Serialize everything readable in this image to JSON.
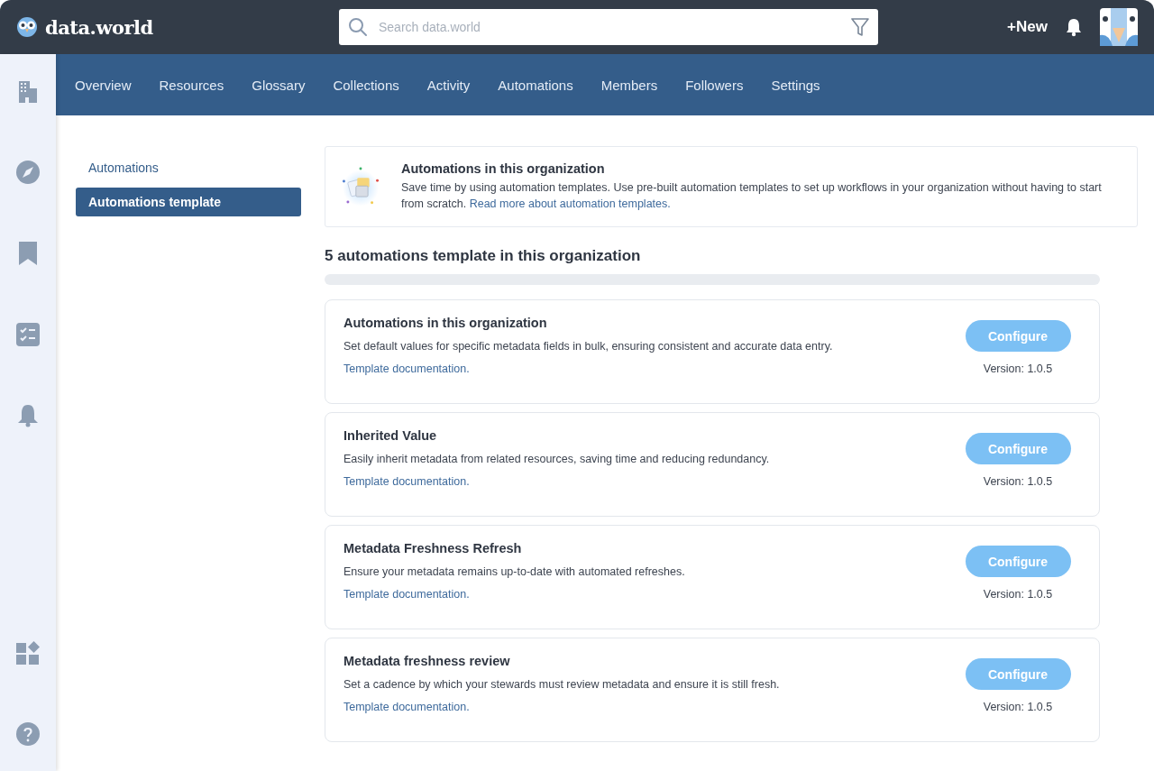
{
  "header": {
    "logo": "data.world",
    "search": {
      "placeholder": "Search data.world"
    },
    "new_button": "+New"
  },
  "nav": {
    "tabs": [
      {
        "label": "Overview",
        "selected": false
      },
      {
        "label": "Resources",
        "selected": false
      },
      {
        "label": "Glossary",
        "selected": false
      },
      {
        "label": "Collections",
        "selected": false
      },
      {
        "label": "Activity",
        "selected": false
      },
      {
        "label": "Automations",
        "selected": false
      },
      {
        "label": "Members",
        "selected": false
      },
      {
        "label": "Followers",
        "selected": false
      },
      {
        "label": "Settings",
        "selected": false
      }
    ]
  },
  "side_menu": [
    {
      "label": "Automations",
      "selected": false
    },
    {
      "label": "Automations template",
      "selected": true
    }
  ],
  "banner": {
    "title": "Automations in this organization",
    "text": "Save time by using automation templates. Use pre-built automation templates to set up workflows in your organization without having to start from scratch.",
    "link": "Read more about automation templates."
  },
  "heading": "5 automations template in this organization",
  "templates": [
    {
      "title": "Automations in this organization",
      "description": "Set default values for specific metadata fields in bulk, ensuring consistent and accurate data entry.",
      "link": "Template documentation.",
      "button": "Configure",
      "version": "Version: 1.0.5"
    },
    {
      "title": "Inherited Value",
      "description": "Easily inherit metadata from related resources, saving time and reducing redundancy.",
      "link": "Template documentation.",
      "button": "Configure",
      "version": "Version: 1.0.5"
    },
    {
      "title": "Metadata Freshness Refresh",
      "description": "Ensure your metadata remains up-to-date with automated refreshes.",
      "link": "Template documentation.",
      "button": "Configure",
      "version": "Version: 1.0.5"
    },
    {
      "title": "Metadata freshness review",
      "description": "Set a cadence by which your stewards must review metadata and ensure it is still fresh.",
      "link": "Template documentation.",
      "button": "Configure",
      "version": "Version: 1.0.5"
    }
  ]
}
